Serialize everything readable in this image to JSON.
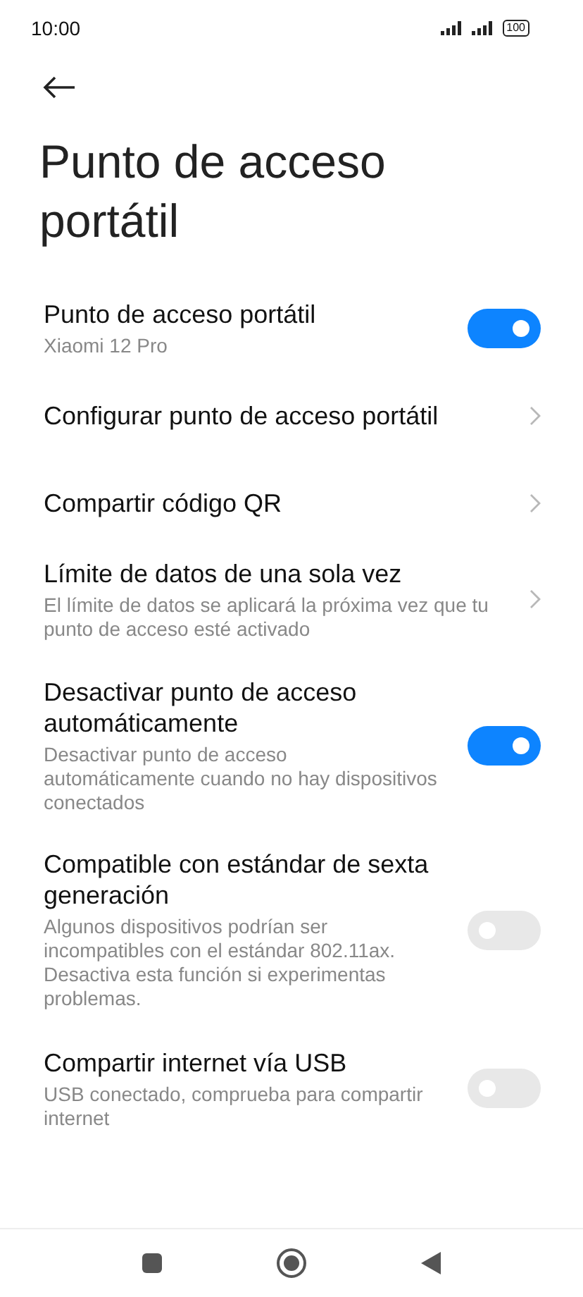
{
  "status_bar": {
    "time": "10:00",
    "battery": "100"
  },
  "title": "Punto de acceso portátil",
  "items": [
    {
      "kind": "toggle",
      "title": "Punto de acceso portátil",
      "subtitle": "Xiaomi 12 Pro",
      "on": true
    },
    {
      "kind": "link",
      "title": "Configurar punto de acceso portátil"
    },
    {
      "kind": "link",
      "title": "Compartir código QR"
    },
    {
      "kind": "link",
      "title": "Límite de datos de una sola vez",
      "subtitle": "El límite de datos se aplicará la próxima vez que tu punto de acceso esté activado"
    },
    {
      "kind": "toggle",
      "title": "Desactivar punto de acceso automáticamente",
      "subtitle": "Desactivar punto de acceso automáticamente cuando no hay dispositivos conectados",
      "on": true
    },
    {
      "kind": "toggle",
      "title": "Compatible con estándar de sexta generación",
      "subtitle": "Algunos dispositivos podrían ser incompatibles con el estándar 802.11ax. Desactiva esta función si experimentas problemas.",
      "on": false
    },
    {
      "kind": "toggle",
      "title": "Compartir internet vía USB",
      "subtitle": "USB conectado, comprueba para compartir internet",
      "on": false
    }
  ]
}
